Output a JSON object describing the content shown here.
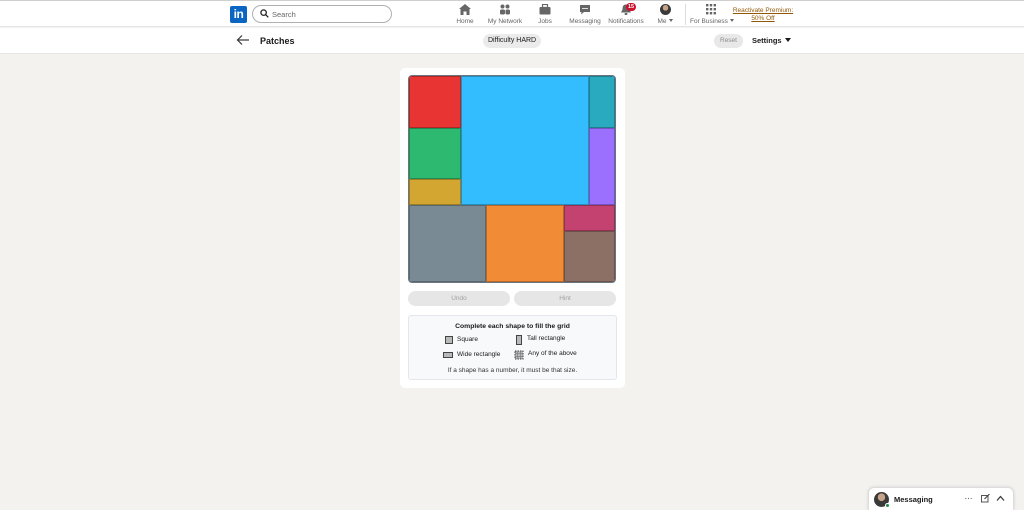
{
  "nav": {
    "logo_text": "in",
    "search_placeholder": "Search",
    "items": [
      {
        "label": "Home",
        "icon": "home-icon"
      },
      {
        "label": "My Network",
        "icon": "network-icon"
      },
      {
        "label": "Jobs",
        "icon": "briefcase-icon"
      },
      {
        "label": "Messaging",
        "icon": "chat-icon"
      },
      {
        "label": "Notifications",
        "icon": "bell-icon",
        "badge": "15"
      },
      {
        "label": "Me",
        "icon": "avatar"
      },
      {
        "label": "For Business",
        "icon": "grid-icon"
      }
    ],
    "premium_line1": "Reactivate Premium:",
    "premium_line2": "50% Off"
  },
  "subheader": {
    "title": "Patches",
    "difficulty": "Difficulty HARD",
    "reset_label": "Reset",
    "settings_label": "Settings"
  },
  "game": {
    "grid_size": 8,
    "patches": [
      {
        "color": "#e93434",
        "col": 0,
        "row": 0,
        "w": 2,
        "h": 2
      },
      {
        "color": "#33bdff",
        "col": 2,
        "row": 0,
        "w": 5,
        "h": 5
      },
      {
        "color": "#2aaabe",
        "col": 7,
        "row": 0,
        "w": 1,
        "h": 2
      },
      {
        "color": "#2db96f",
        "col": 0,
        "row": 2,
        "w": 2,
        "h": 2
      },
      {
        "color": "#9b70fe",
        "col": 7,
        "row": 2,
        "w": 1,
        "h": 3
      },
      {
        "color": "#d2a630",
        "col": 0,
        "row": 4,
        "w": 2,
        "h": 1
      },
      {
        "color": "#7a8a94",
        "col": 0,
        "row": 5,
        "w": 3,
        "h": 3
      },
      {
        "color": "#f28b35",
        "col": 3,
        "row": 5,
        "w": 3,
        "h": 3
      },
      {
        "color": "#c44270",
        "col": 6,
        "row": 5,
        "w": 2,
        "h": 1
      },
      {
        "color": "#8c6f65",
        "col": 6,
        "row": 6,
        "w": 2,
        "h": 2
      }
    ],
    "undo_label": "Undo",
    "hint_label": "Hint",
    "legend": {
      "title": "Complete each shape to fill the grid",
      "square": "Square",
      "tall": "Tall rectangle",
      "wide": "Wide rectangle",
      "any": "Any of the above",
      "note": "If a shape has a number, it must be that size."
    }
  },
  "messaging": {
    "label": "Messaging"
  }
}
